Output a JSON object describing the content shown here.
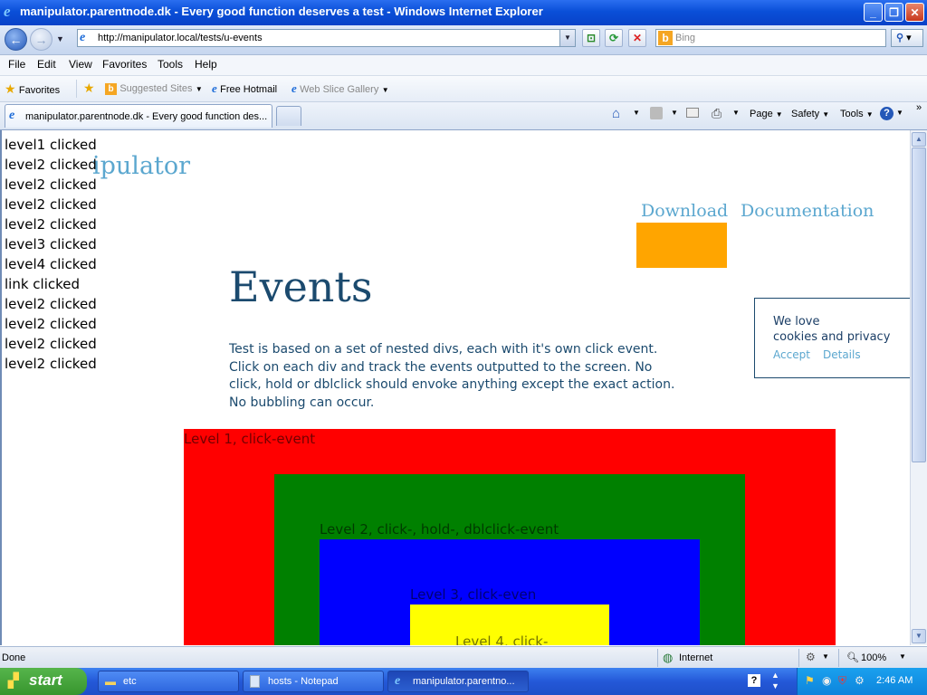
{
  "window": {
    "title": "manipulator.parentnode.dk - Every good function deserves a test - Windows Internet Explorer"
  },
  "addressbar": {
    "url": "http://manipulator.local/tests/u-events",
    "search_placeholder": "Bing"
  },
  "menubar": {
    "items": [
      "File",
      "Edit",
      "View",
      "Favorites",
      "Tools",
      "Help"
    ]
  },
  "favbar": {
    "favorites": "Favorites",
    "suggested": "Suggested Sites",
    "hotmail": "Free Hotmail",
    "webslice": "Web Slice Gallery"
  },
  "tab": {
    "label": "manipulator.parentnode.dk - Every good function des..."
  },
  "commandbar": {
    "page": "Page",
    "safety": "Safety",
    "tools": "Tools"
  },
  "page": {
    "logo": "ipulator",
    "nav": [
      "Download",
      "Documentation"
    ],
    "heading": "Events",
    "description": "Test is based on a set of nested divs, each with it's own click event. Click on each div and track the events outputted to the screen. No click, hold or dblclick should envoke anything except the exact action. No bubbling can occur.",
    "log": [
      "level1 clicked",
      "level2 clicked",
      "level2 clicked",
      "level2 clicked",
      "level2 clicked",
      "level3 clicked",
      "level4 clicked",
      "link clicked",
      "level2 clicked",
      "level2 clicked",
      "level2 clicked",
      "level2 clicked"
    ],
    "cookie": {
      "line1": "We love",
      "line2": "cookies and privacy",
      "accept": "Accept",
      "details": "Details"
    },
    "levels": {
      "l1": "Level 1, click-event",
      "l2": "Level 2, click-, hold-, dblclick-event",
      "l3": "Level 3, click-even",
      "l4": "Level 4, click-"
    },
    "colors": {
      "level1": "#ff0000",
      "level2": "#008000",
      "level3": "#0000ff",
      "level4": "#ffff00",
      "orange_box": "#ffa500",
      "heading": "#1b4a6e",
      "link": "#5ba7cf"
    }
  },
  "statusbar": {
    "status": "Done",
    "zone": "Internet",
    "zoom": "100%"
  },
  "taskbar": {
    "start": "start",
    "tasks": [
      "etc",
      "hosts - Notepad",
      "manipulator.parentno..."
    ],
    "clock": "2:46 AM"
  }
}
